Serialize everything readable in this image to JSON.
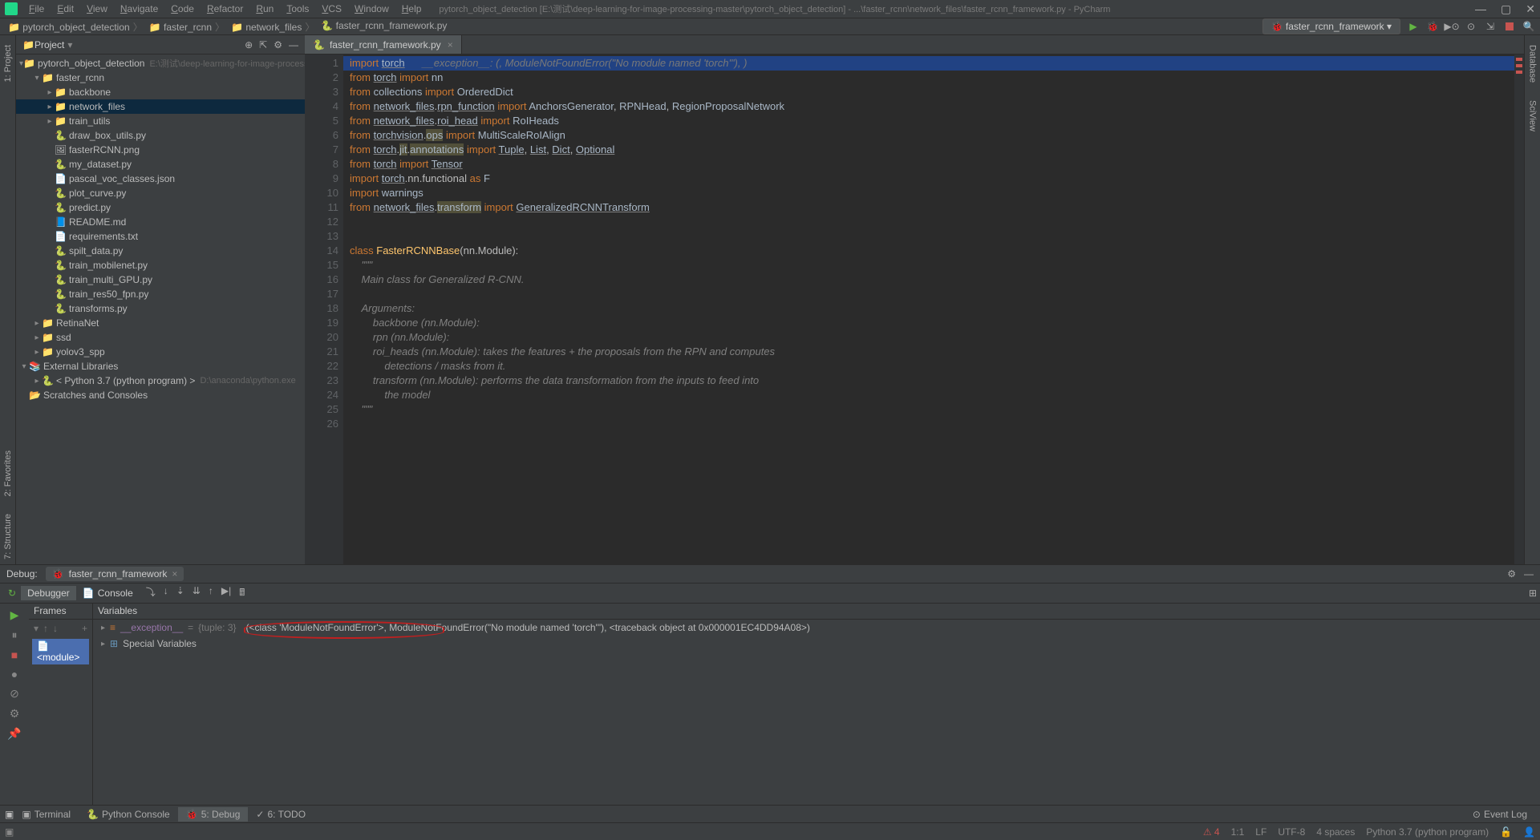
{
  "window": {
    "title": "pytorch_object_detection [E:\\测试\\deep-learning-for-image-processing-master\\pytorch_object_detection] - ...\\faster_rcnn\\network_files\\faster_rcnn_framework.py - PyCharm"
  },
  "menus": [
    "File",
    "Edit",
    "View",
    "Navigate",
    "Code",
    "Refactor",
    "Run",
    "Tools",
    "VCS",
    "Window",
    "Help"
  ],
  "breadcrumbs": [
    "pytorch_object_detection",
    "faster_rcnn",
    "network_files",
    "faster_rcnn_framework.py"
  ],
  "runconfig": "faster_rcnn_framework",
  "project": {
    "title": "Project",
    "tree": [
      {
        "lvl": 0,
        "arrow": "▾",
        "ico": "📁",
        "txt": "pytorch_object_detection",
        "dim": "E:\\测试\\deep-learning-for-image-processing-m"
      },
      {
        "lvl": 1,
        "arrow": "▾",
        "ico": "📁",
        "txt": "faster_rcnn"
      },
      {
        "lvl": 2,
        "arrow": "▸",
        "ico": "📁",
        "txt": "backbone"
      },
      {
        "lvl": 2,
        "arrow": "▸",
        "ico": "📁",
        "txt": "network_files",
        "sel": true
      },
      {
        "lvl": 2,
        "arrow": "▸",
        "ico": "📁",
        "txt": "train_utils"
      },
      {
        "lvl": 2,
        "arrow": "",
        "ico": "🐍",
        "txt": "draw_box_utils.py"
      },
      {
        "lvl": 2,
        "arrow": "",
        "ico": "🖼",
        "txt": "fasterRCNN.png"
      },
      {
        "lvl": 2,
        "arrow": "",
        "ico": "🐍",
        "txt": "my_dataset.py"
      },
      {
        "lvl": 2,
        "arrow": "",
        "ico": "📄",
        "txt": "pascal_voc_classes.json"
      },
      {
        "lvl": 2,
        "arrow": "",
        "ico": "🐍",
        "txt": "plot_curve.py"
      },
      {
        "lvl": 2,
        "arrow": "",
        "ico": "🐍",
        "txt": "predict.py"
      },
      {
        "lvl": 2,
        "arrow": "",
        "ico": "📘",
        "txt": "README.md"
      },
      {
        "lvl": 2,
        "arrow": "",
        "ico": "📄",
        "txt": "requirements.txt"
      },
      {
        "lvl": 2,
        "arrow": "",
        "ico": "🐍",
        "txt": "spilt_data.py"
      },
      {
        "lvl": 2,
        "arrow": "",
        "ico": "🐍",
        "txt": "train_mobilenet.py"
      },
      {
        "lvl": 2,
        "arrow": "",
        "ico": "🐍",
        "txt": "train_multi_GPU.py"
      },
      {
        "lvl": 2,
        "arrow": "",
        "ico": "🐍",
        "txt": "train_res50_fpn.py"
      },
      {
        "lvl": 2,
        "arrow": "",
        "ico": "🐍",
        "txt": "transforms.py"
      },
      {
        "lvl": 1,
        "arrow": "▸",
        "ico": "📁",
        "txt": "RetinaNet"
      },
      {
        "lvl": 1,
        "arrow": "▸",
        "ico": "📁",
        "txt": "ssd"
      },
      {
        "lvl": 1,
        "arrow": "▸",
        "ico": "📁",
        "txt": "yolov3_spp"
      },
      {
        "lvl": 0,
        "arrow": "▾",
        "ico": "📚",
        "txt": "External Libraries"
      },
      {
        "lvl": 1,
        "arrow": "▸",
        "ico": "🐍",
        "txt": "< Python 3.7 (python program) >",
        "dim": "D:\\anaconda\\python.exe"
      },
      {
        "lvl": 0,
        "arrow": "",
        "ico": "📂",
        "txt": "Scratches and Consoles"
      }
    ]
  },
  "editor": {
    "tab": "faster_rcnn_framework.py",
    "inlay": "__exception__: (<class 'ModuleNotFoundError'>, ModuleNotFoundError(\"No module named 'torch'\"), <traceback object at 0x000001EC4DD94A08>)",
    "lines": [
      {
        "n": 1,
        "hl": true,
        "html": "<span class='kw'>import</span> <span class='id und'>torch</span>"
      },
      {
        "n": 2,
        "html": "<span class='kw'>from</span> <span class='id und'>torch</span> <span class='kw'>import</span> <span class='id'>nn</span>"
      },
      {
        "n": 3,
        "html": "<span class='kw'>from</span> <span class='id'>collections</span> <span class='kw'>import</span> <span class='id'>OrderedDict</span>"
      },
      {
        "n": 4,
        "html": "<span class='kw'>from</span> <span class='id und'>network_files</span>.<span class='id und'>rpn_function</span> <span class='kw'>import</span> <span class='id'>AnchorsGenerator</span>, <span class='id'>RPNHead</span>, <span class='id'>RegionProposalNetwork</span>"
      },
      {
        "n": 5,
        "html": "<span class='kw'>from</span> <span class='id und'>network_files</span>.<span class='id und'>roi_head</span> <span class='kw'>import</span> <span class='id'>RoIHeads</span>"
      },
      {
        "n": 6,
        "html": "<span class='kw'>from</span> <span class='id und'>torchvision</span>.<span class='id wund'>ops</span> <span class='kw'>import</span> <span class='id'>MultiScaleRoIAlign</span>"
      },
      {
        "n": 7,
        "html": "<span class='kw'>from</span> <span class='id und'>torch</span>.<span class='id wund'>jit</span>.<span class='id wund'>annotations</span> <span class='kw'>import</span> <span class='id und'>Tuple</span>, <span class='id und'>List</span>, <span class='id und'>Dict</span>, <span class='id und'>Optional</span>"
      },
      {
        "n": 8,
        "html": "<span class='kw'>from</span> <span class='id und'>torch</span> <span class='kw'>import</span> <span class='id und'>Tensor</span>"
      },
      {
        "n": 9,
        "html": "<span class='kw'>import</span> <span class='id und'>torch</span>.nn.functional <span class='kw'>as</span> <span class='id'>F</span>"
      },
      {
        "n": 10,
        "html": "<span class='kw'>import</span> <span class='id'>warnings</span>"
      },
      {
        "n": 11,
        "html": "<span class='kw'>from</span> <span class='id und'>network_files</span>.<span class='id wund'>transform</span> <span class='kw'>import</span> <span class='id und'>GeneralizedRCNNTransform</span>"
      },
      {
        "n": 12,
        "html": ""
      },
      {
        "n": 13,
        "html": ""
      },
      {
        "n": 14,
        "html": "<span class='kw'>class</span> <span class='fn'>FasterRCNNBase</span>(nn.Module):"
      },
      {
        "n": 15,
        "html": "    <span class='cm'>\"\"\"</span>"
      },
      {
        "n": 16,
        "html": "    <span class='cm'>Main class for Generalized R-CNN.</span>"
      },
      {
        "n": 17,
        "html": ""
      },
      {
        "n": 18,
        "html": "    <span class='cm'>Arguments:</span>"
      },
      {
        "n": 19,
        "html": "        <span class='cm'>backbone (nn.Module):</span>"
      },
      {
        "n": 20,
        "html": "        <span class='cm'>rpn (nn.Module):</span>"
      },
      {
        "n": 21,
        "html": "        <span class='cm'>roi_heads (nn.Module): takes the features + the proposals from the RPN and computes</span>"
      },
      {
        "n": 22,
        "html": "            <span class='cm'>detections / masks from it.</span>"
      },
      {
        "n": 23,
        "html": "        <span class='cm'>transform (nn.Module): performs the data transformation from the inputs to feed into</span>"
      },
      {
        "n": 24,
        "html": "            <span class='cm'>the model</span>"
      },
      {
        "n": 25,
        "html": "    <span class='cm'>\"\"\"</span>"
      },
      {
        "n": 26,
        "html": ""
      }
    ]
  },
  "debug": {
    "title": "Debug:",
    "config": "faster_rcnn_framework",
    "tabs": {
      "debugger": "Debugger",
      "console": "Console"
    },
    "framesTitle": "Frames",
    "varsTitle": "Variables",
    "frameItem": "<module>",
    "exceptionVar": "__exception__",
    "exceptionType": "{tuple: 3}",
    "exceptionValue": "(<class 'ModuleNotFoundError'>, ModuleNotFoundError(\"No module named 'torch'\"), <traceback object at 0x000001EC4DD94A08>)",
    "specialVars": "Special Variables"
  },
  "bottomTabs": {
    "terminal": "Terminal",
    "pycon": "Python Console",
    "debug": "5: Debug",
    "todo": "6: TODO",
    "eventlog": "Event Log"
  },
  "status": {
    "errs": "4",
    "pos": "1:1",
    "lf": "LF",
    "enc": "UTF-8",
    "indent": "4 spaces",
    "interp": "Python 3.7 (python program)"
  },
  "sidetabs": {
    "project": "1: Project",
    "favorites": "2: Favorites",
    "structure": "7: Structure",
    "database": "Database",
    "sciview": "SciView"
  }
}
